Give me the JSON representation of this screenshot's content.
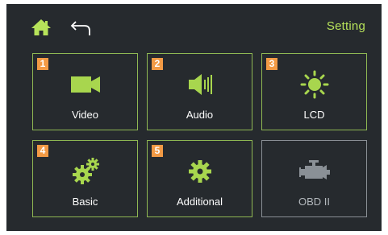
{
  "header": {
    "title": "Setting",
    "home_icon": "home-icon",
    "back_icon": "back-arrow-icon"
  },
  "colors": {
    "background": "#262a2e",
    "accent": "#b7e35a",
    "tile_border": "#8fb853",
    "badge": "#f29a45",
    "disabled": "#8a9096"
  },
  "tiles": [
    {
      "number": "1",
      "label": "Video",
      "icon": "video-camera-icon",
      "enabled": true
    },
    {
      "number": "2",
      "label": "Audio",
      "icon": "speaker-icon",
      "enabled": true
    },
    {
      "number": "3",
      "label": "LCD",
      "icon": "brightness-icon",
      "enabled": true
    },
    {
      "number": "4",
      "label": "Basic",
      "icon": "gears-icon",
      "enabled": true
    },
    {
      "number": "5",
      "label": "Additional",
      "icon": "gear-icon",
      "enabled": true
    },
    {
      "label": "OBD II",
      "icon": "engine-icon",
      "enabled": false
    }
  ]
}
